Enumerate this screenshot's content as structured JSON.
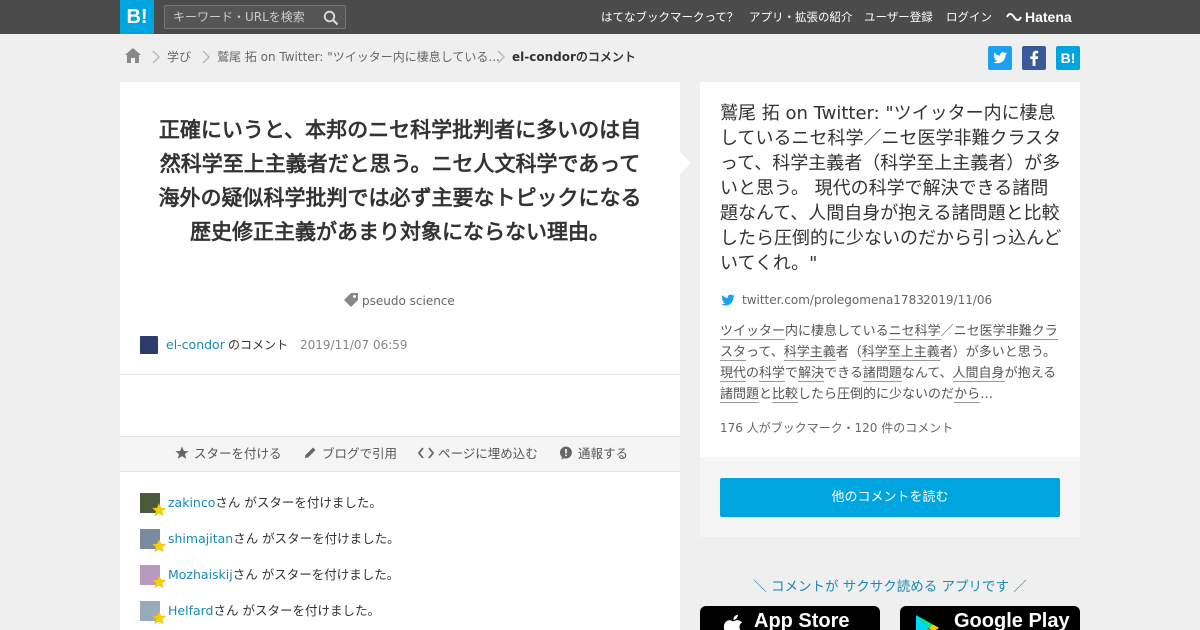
{
  "header": {
    "logo": "B!",
    "search_placeholder": "キーワード・URLを検索",
    "nav": [
      "はてなブックマークって？",
      "アプリ・拡張の紹介",
      "ユーザー登録",
      "ログイン"
    ],
    "brand": "Hatena"
  },
  "breadcrumb": {
    "items": [
      "学び",
      "鷲尾 拓 on Twitter: \"ツイッター内に棲息している...",
      "el-condorのコメント"
    ]
  },
  "share": {
    "bookmark_label": "B!"
  },
  "comment": {
    "text": "正確にいうと、本邦のニセ科学批判者に多いのは自然科学至上主義者だと思う。ニセ人文科学であって海外の疑似科学批判では必ず主要なトピックになる歴史修正主義があまり対象にならない理由。",
    "tag": "pseudo science",
    "user": "el-condor",
    "user_suffix": "のコメント",
    "datetime": "2019/11/07 06:59"
  },
  "actions": [
    {
      "label": "スターを付ける",
      "icon": "star-icon"
    },
    {
      "label": "ブログで引用",
      "icon": "pencil-icon"
    },
    {
      "label": "ページに埋め込む",
      "icon": "code-icon"
    },
    {
      "label": "通報する",
      "icon": "report-icon"
    }
  ],
  "stars": {
    "suffix": "さん がスターを付けました。",
    "users": [
      "zakinco",
      "shimajitan",
      "Mozhaiskij",
      "Helfard"
    ]
  },
  "entry": {
    "title": "鷲尾 拓 on Twitter: \"ツイッター内に棲息しているニセ科学／ニセ医学非難クラスタって、科学主義者（科学至上主義者）が多いと思う。 現代の科学で解決できる諸問題なんて、人間自身が抱える諸問題と比較したら圧倒的に少ないのだから引っ込んどいてくれ。\"",
    "source": "twitter.com/prolegomena1783",
    "date": "2019/11/06",
    "body": {
      "p1": "ツイッター",
      "p2": "内に棲息している",
      "p3": "ニセ科学",
      "p4": "／ニセ",
      "p5": "医学",
      "p6": "非難クラスタ",
      "p7": "って、",
      "p8": "科学主義",
      "p9": "者（",
      "p10": "科学至上主義",
      "p11": "者）が多いと思う。",
      "p12": "現代",
      "p13": "の",
      "p14": "科学",
      "p15": "で",
      "p16": "解決",
      "p17": "できる",
      "p18": "諸問題",
      "p19": "なんて、",
      "p20": "人間自身",
      "p21": "が抱える",
      "p22": "諸問題",
      "p23": "と",
      "p24": "比較",
      "p25": "したら圧倒的に少ないのだ",
      "p26": "から",
      "p27": "…"
    },
    "stats": "176 人がブックマーク・120 件のコメント",
    "read_button": "他のコメントを読む"
  },
  "promo": {
    "text": "＼ コメントが サクサク読める アプリです ／",
    "app_store": "App Store",
    "google_play": "Google Play"
  },
  "colors": {
    "accent": "#00a4de",
    "link": "#1a8ab5",
    "twitter": "#1da1f2",
    "facebook": "#3b5998",
    "header": "#4b4b4b",
    "star": "#f7d000"
  }
}
